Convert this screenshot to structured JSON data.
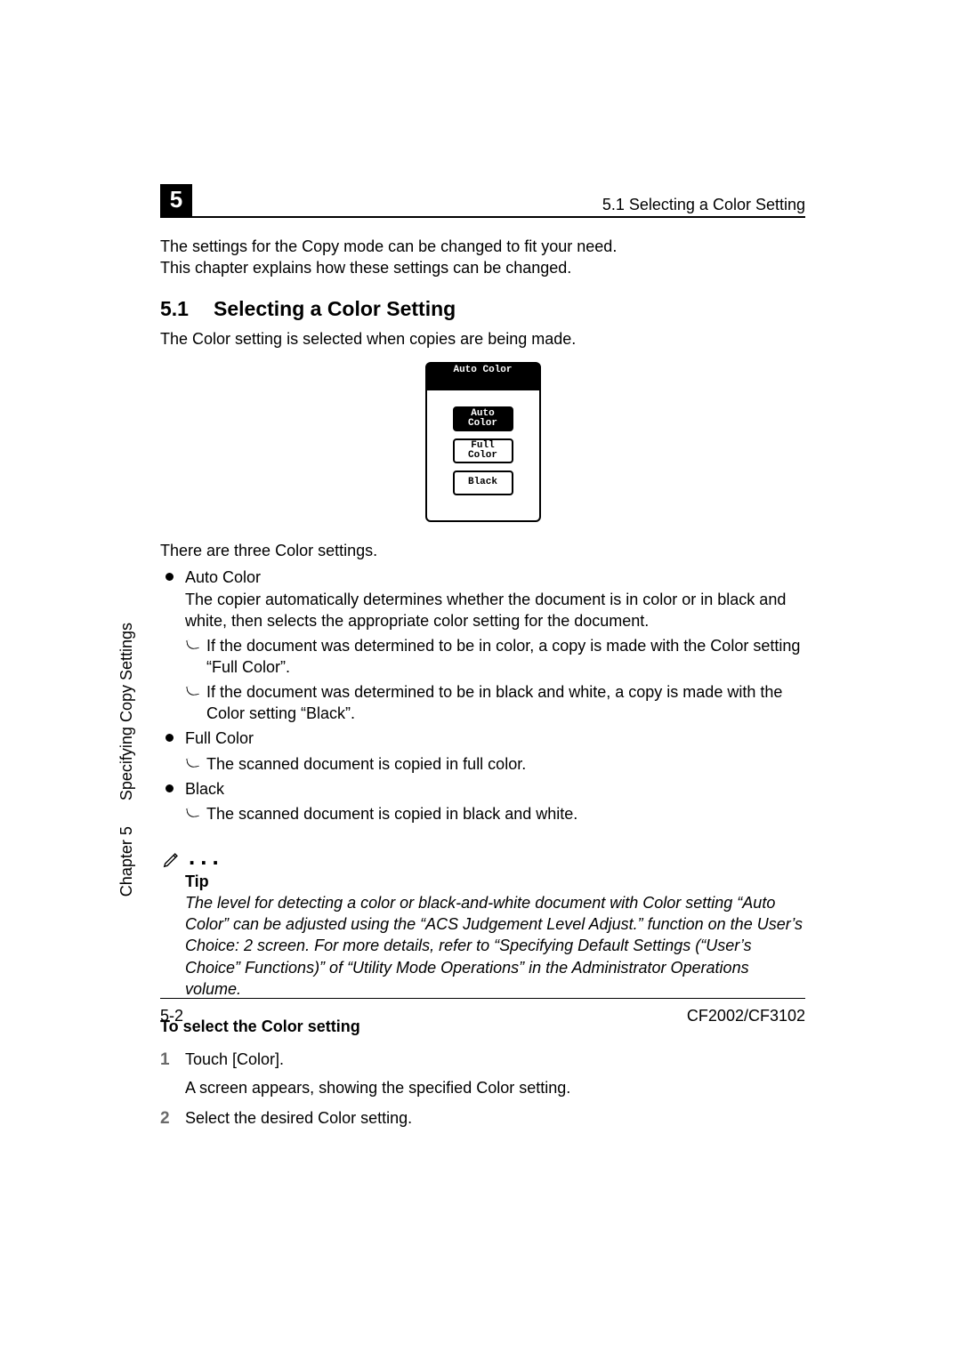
{
  "chapter_number": "5",
  "running_head": "5.1 Selecting a Color Setting",
  "intro_line1": "The settings for the Copy mode can be changed to fit your need.",
  "intro_line2": "This chapter explains how these settings can be changed.",
  "section": {
    "number": "5.1",
    "title": "Selecting a Color Setting",
    "lead": "The Color setting is selected when copies are being made."
  },
  "panel": {
    "title": "Auto Color",
    "btn_auto": "Auto Color",
    "btn_full": "Full Color",
    "btn_black": "Black"
  },
  "three_settings_lead": "There are three Color settings.",
  "settings": {
    "auto": {
      "name": "Auto Color",
      "desc": "The copier automatically determines whether the document is in color or in black and white, then selects the appropriate color setting for the document.",
      "sub1": "If the document was determined to be in color, a copy is made with the Color setting “Full Color”.",
      "sub2": "If the document was determined to be in black and white, a copy is made with the Color setting “Black”."
    },
    "full": {
      "name": "Full Color",
      "sub1": "The scanned document is copied in full color."
    },
    "black": {
      "name": "Black",
      "sub1": "The scanned document is copied in black and white."
    }
  },
  "tip": {
    "heading": "Tip",
    "body": "The level for detecting a color or black-and-white document with Color setting “Auto Color” can be adjusted using the “ACS Judgement Level Adjust.” function on the User’s Choice: 2 screen. For more details, refer to “Specifying Default Settings (“User’s Choice” Functions)” of “Utility Mode Operations” in the Administrator Operations volume."
  },
  "procedure": {
    "heading": "To select the Color setting",
    "step1": {
      "num": "1",
      "text": "Touch [Color].",
      "sub": "A screen appears, showing the specified Color setting."
    },
    "step2": {
      "num": "2",
      "text": "Select the desired Color setting."
    }
  },
  "footer": {
    "left": "5-2",
    "right": "CF2002/CF3102"
  },
  "side": {
    "chapter": "Chapter 5",
    "title": "Specifying Copy Settings"
  }
}
